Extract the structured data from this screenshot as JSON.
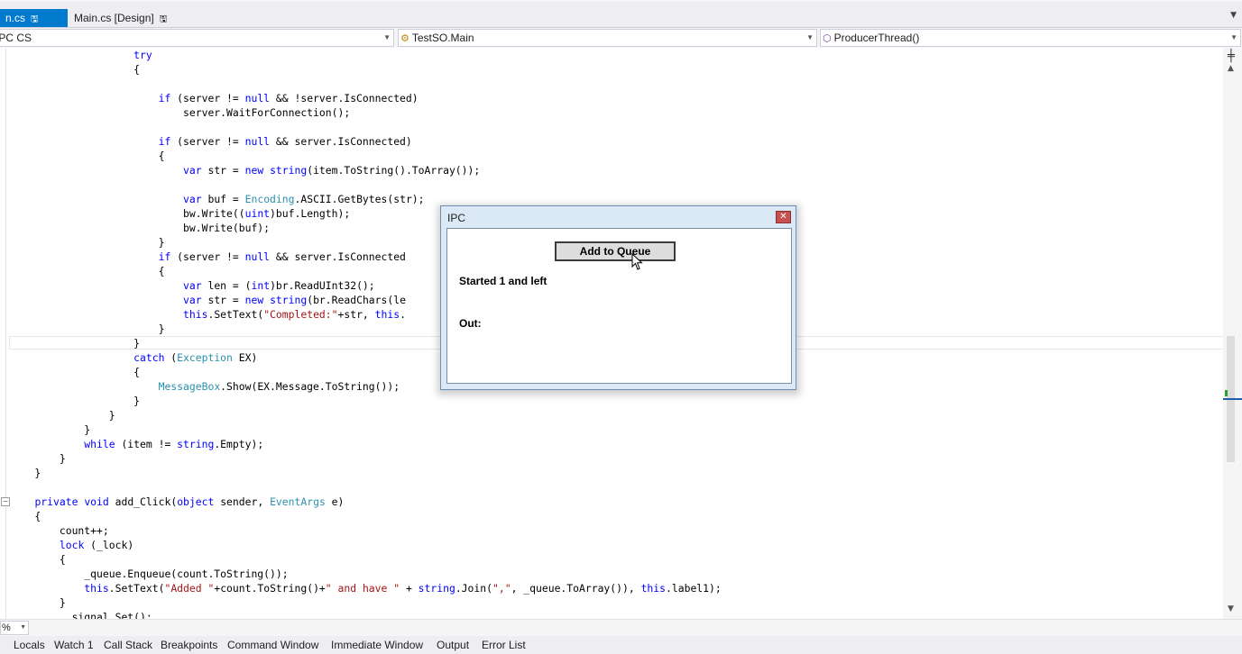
{
  "tabs": [
    {
      "label": "n.cs",
      "pin_glyph": "🖫",
      "pin2_glyph": "⊣",
      "close_glyph": "✕"
    },
    {
      "label": "Main.cs [Design]",
      "pin_glyph": "🖫"
    }
  ],
  "navbar": {
    "project": "IPC CS",
    "type": "TestSO.Main",
    "member": "ProducerThread()"
  },
  "code_lines": [
    [
      {
        "t": "                    "
      },
      {
        "t": "try",
        "c": "kw"
      }
    ],
    [
      {
        "t": "                    {"
      }
    ],
    [
      {
        "t": ""
      }
    ],
    [
      {
        "t": "                        "
      },
      {
        "t": "if",
        "c": "kw"
      },
      {
        "t": " (server != "
      },
      {
        "t": "null",
        "c": "kw"
      },
      {
        "t": " && !server.IsConnected)"
      }
    ],
    [
      {
        "t": "                            server.WaitForConnection();"
      }
    ],
    [
      {
        "t": ""
      }
    ],
    [
      {
        "t": "                        "
      },
      {
        "t": "if",
        "c": "kw"
      },
      {
        "t": " (server != "
      },
      {
        "t": "null",
        "c": "kw"
      },
      {
        "t": " && server.IsConnected)"
      }
    ],
    [
      {
        "t": "                        {"
      }
    ],
    [
      {
        "t": "                            "
      },
      {
        "t": "var",
        "c": "kw"
      },
      {
        "t": " str = "
      },
      {
        "t": "new",
        "c": "kw"
      },
      {
        "t": " "
      },
      {
        "t": "string",
        "c": "kw"
      },
      {
        "t": "(item.ToString().ToArray());"
      }
    ],
    [
      {
        "t": ""
      }
    ],
    [
      {
        "t": "                            "
      },
      {
        "t": "var",
        "c": "kw"
      },
      {
        "t": " buf = "
      },
      {
        "t": "Encoding",
        "c": "ty"
      },
      {
        "t": ".ASCII.GetBytes(str);"
      }
    ],
    [
      {
        "t": "                            bw.Write(("
      },
      {
        "t": "uint",
        "c": "kw"
      },
      {
        "t": ")buf.Length);"
      }
    ],
    [
      {
        "t": "                            bw.Write(buf);"
      }
    ],
    [
      {
        "t": "                        }"
      }
    ],
    [
      {
        "t": "                        "
      },
      {
        "t": "if",
        "c": "kw"
      },
      {
        "t": " (server != "
      },
      {
        "t": "null",
        "c": "kw"
      },
      {
        "t": " && server.IsConnected"
      }
    ],
    [
      {
        "t": "                        {"
      }
    ],
    [
      {
        "t": "                            "
      },
      {
        "t": "var",
        "c": "kw"
      },
      {
        "t": " len = ("
      },
      {
        "t": "int",
        "c": "kw"
      },
      {
        "t": ")br.ReadUInt32();"
      }
    ],
    [
      {
        "t": "                            "
      },
      {
        "t": "var",
        "c": "kw"
      },
      {
        "t": " str = "
      },
      {
        "t": "new",
        "c": "kw"
      },
      {
        "t": " "
      },
      {
        "t": "string",
        "c": "kw"
      },
      {
        "t": "(br.ReadChars(le"
      }
    ],
    [
      {
        "t": "                            "
      },
      {
        "t": "this",
        "c": "kw"
      },
      {
        "t": ".SetText("
      },
      {
        "t": "\"Completed:\"",
        "c": "st"
      },
      {
        "t": "+str, "
      },
      {
        "t": "this",
        "c": "kw"
      },
      {
        "t": "."
      }
    ],
    [
      {
        "t": "                        }"
      }
    ],
    [
      {
        "t": "                    }"
      }
    ],
    [
      {
        "t": "                    "
      },
      {
        "t": "catch",
        "c": "kw"
      },
      {
        "t": " ("
      },
      {
        "t": "Exception",
        "c": "ty"
      },
      {
        "t": " EX)"
      }
    ],
    [
      {
        "t": "                    {"
      }
    ],
    [
      {
        "t": "                        "
      },
      {
        "t": "MessageBox",
        "c": "ty"
      },
      {
        "t": ".Show(EX.Message.ToString());"
      }
    ],
    [
      {
        "t": "                    }"
      }
    ],
    [
      {
        "t": "                }"
      }
    ],
    [
      {
        "t": "            }"
      }
    ],
    [
      {
        "t": "            "
      },
      {
        "t": "while",
        "c": "kw"
      },
      {
        "t": " (item != "
      },
      {
        "t": "string",
        "c": "kw"
      },
      {
        "t": ".Empty);"
      }
    ],
    [
      {
        "t": "        }"
      }
    ],
    [
      {
        "t": "    }"
      }
    ],
    [
      {
        "t": ""
      }
    ],
    [
      {
        "t": "    "
      },
      {
        "t": "private",
        "c": "kw"
      },
      {
        "t": " "
      },
      {
        "t": "void",
        "c": "kw"
      },
      {
        "t": " add_Click("
      },
      {
        "t": "object",
        "c": "kw"
      },
      {
        "t": " sender, "
      },
      {
        "t": "EventArgs",
        "c": "ty"
      },
      {
        "t": " e)"
      }
    ],
    [
      {
        "t": "    {"
      }
    ],
    [
      {
        "t": "        count++;"
      }
    ],
    [
      {
        "t": "        "
      },
      {
        "t": "lock",
        "c": "kw"
      },
      {
        "t": " (_lock)"
      }
    ],
    [
      {
        "t": "        {"
      }
    ],
    [
      {
        "t": "            _queue.Enqueue(count.ToString());"
      }
    ],
    [
      {
        "t": "            "
      },
      {
        "t": "this",
        "c": "kw"
      },
      {
        "t": ".SetText("
      },
      {
        "t": "\"Added \"",
        "c": "st"
      },
      {
        "t": "+count.ToString()+"
      },
      {
        "t": "\" and have \"",
        "c": "st"
      },
      {
        "t": " + "
      },
      {
        "t": "string",
        "c": "kw"
      },
      {
        "t": ".Join("
      },
      {
        "t": "\",\"",
        "c": "st"
      },
      {
        "t": ", _queue.ToArray()), "
      },
      {
        "t": "this",
        "c": "kw"
      },
      {
        "t": ".label1);"
      }
    ],
    [
      {
        "t": "        }"
      }
    ],
    [
      {
        "t": "         _signal.Set();"
      }
    ]
  ],
  "zoom": {
    "value": "%"
  },
  "tool_tabs": [
    "Locals",
    "Watch 1",
    "Call Stack",
    "Breakpoints",
    "Command Window",
    "Immediate Window",
    "Output",
    "Error List"
  ],
  "ipc_window": {
    "title": "IPC",
    "button_label": "Add to Queue",
    "status_label": "Started 1 and left",
    "output_label": "Out:"
  }
}
